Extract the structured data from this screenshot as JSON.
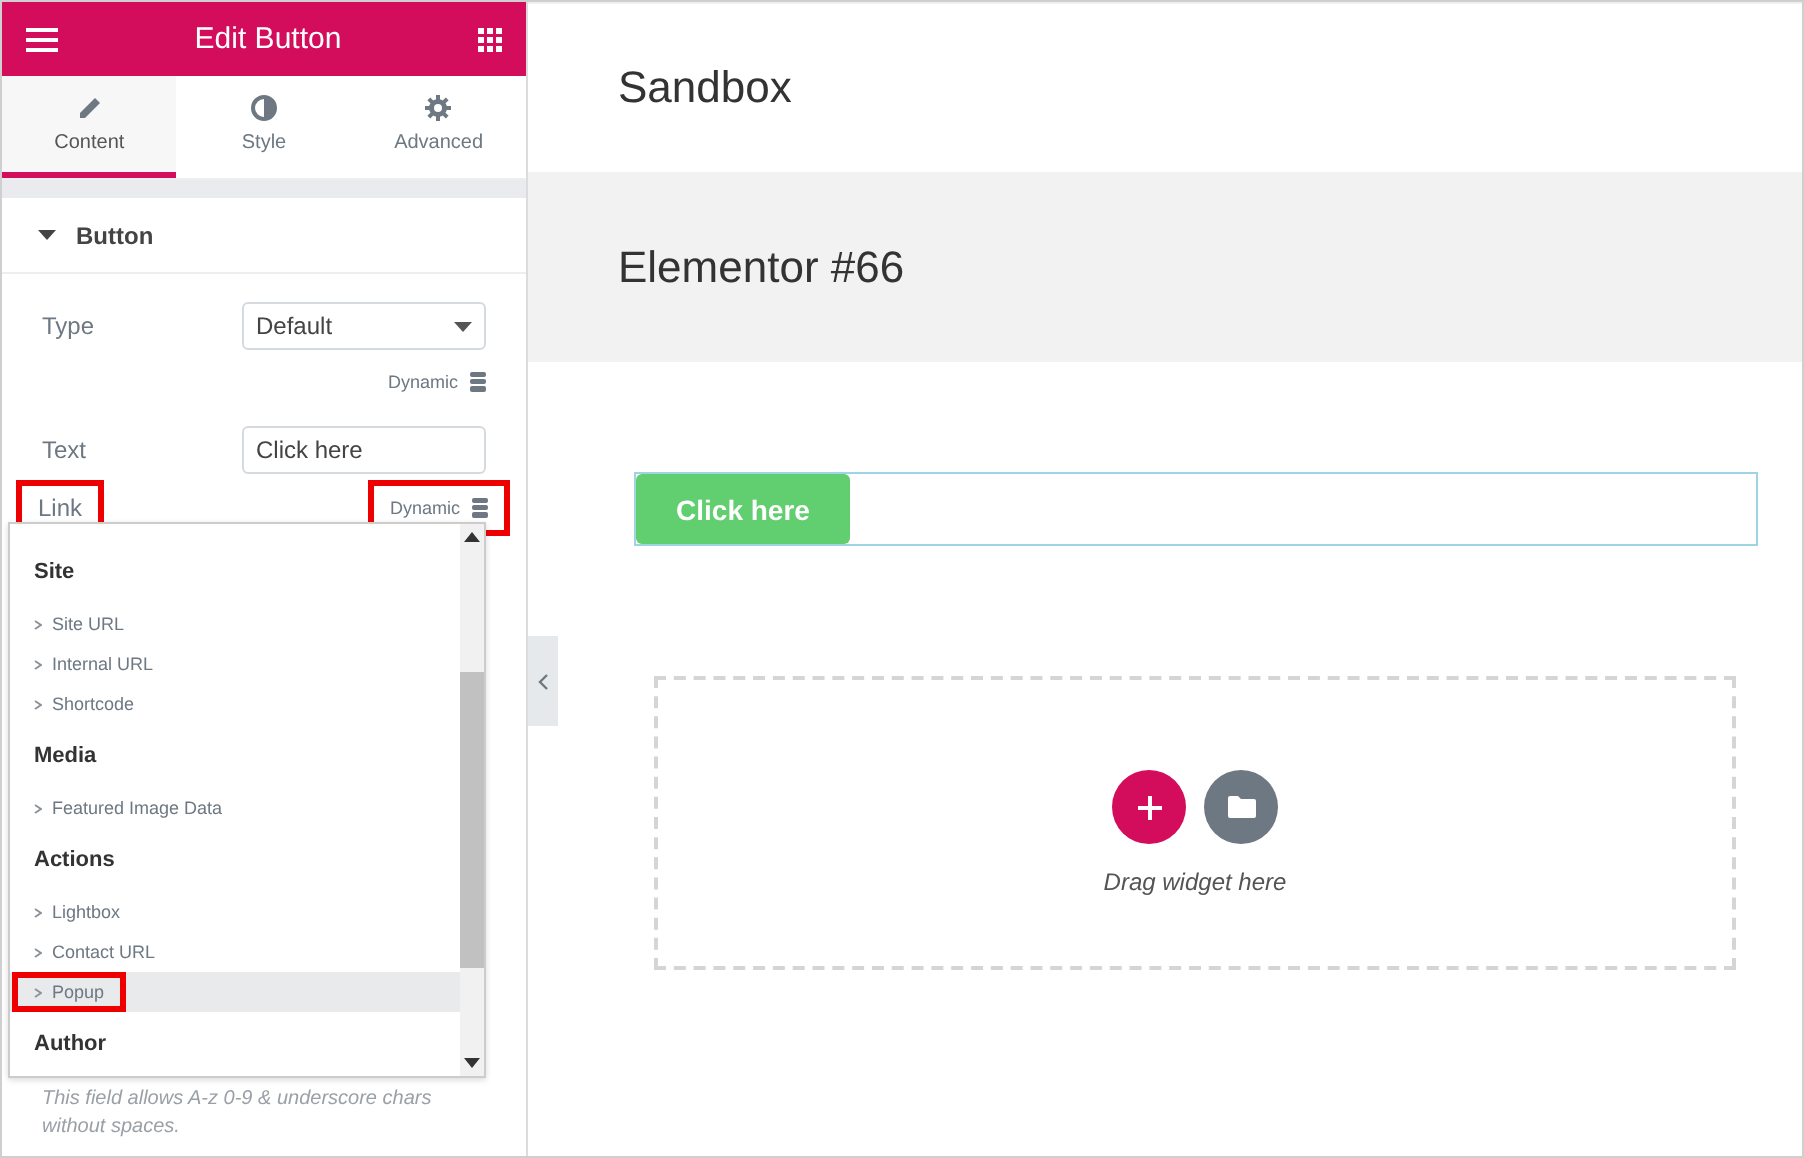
{
  "panel": {
    "title": "Edit Button",
    "tabs": [
      {
        "label": "Content",
        "selected": true
      },
      {
        "label": "Style",
        "selected": false
      },
      {
        "label": "Advanced",
        "selected": false
      }
    ],
    "section": {
      "title": "Button",
      "expanded": true
    },
    "fields": [
      {
        "kind": "select",
        "label": "Type",
        "value": "Default"
      },
      {
        "kind": "dynamic",
        "label": "Dynamic",
        "highlighted": false
      },
      {
        "kind": "text",
        "label": "Text",
        "value": "Click here"
      },
      {
        "kind": "link",
        "label": "Link",
        "highlighted": true,
        "dynamic": {
          "label": "Dynamic",
          "highlighted": true
        }
      }
    ],
    "dropdown": {
      "groups": [
        {
          "title": "Site",
          "items": [
            {
              "label": "Site URL",
              "selected": false,
              "highlighted": false
            },
            {
              "label": "Internal URL",
              "selected": false,
              "highlighted": false
            },
            {
              "label": "Shortcode",
              "selected": false,
              "highlighted": false
            }
          ]
        },
        {
          "title": "Media",
          "items": [
            {
              "label": "Featured Image Data",
              "selected": false,
              "highlighted": false
            }
          ]
        },
        {
          "title": "Actions",
          "items": [
            {
              "label": "Lightbox",
              "selected": false,
              "highlighted": false
            },
            {
              "label": "Contact URL",
              "selected": false,
              "highlighted": false
            },
            {
              "label": "Popup",
              "selected": true,
              "highlighted": true
            }
          ]
        },
        {
          "title": "Author"
        }
      ]
    },
    "help_text": "This field allows A-z  0-9 & underscore chars without spaces."
  },
  "canvas": {
    "site_title": "Sandbox",
    "page_title": "Elementor #66",
    "button": {
      "label": "Click here"
    },
    "drop_zone": {
      "hint": "Drag widget here"
    }
  }
}
